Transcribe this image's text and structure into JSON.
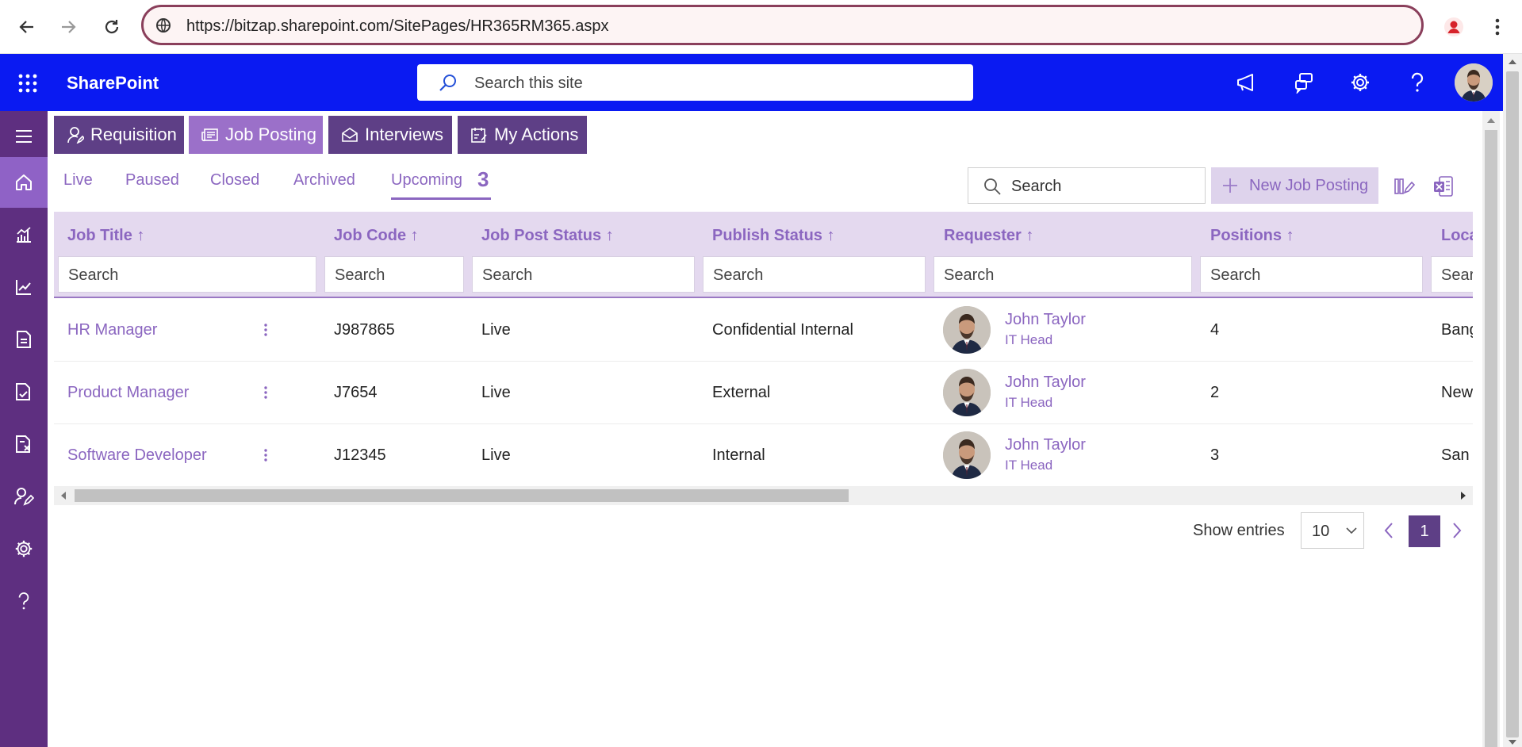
{
  "browser": {
    "url": "https://bitzap.sharepoint.com/SitePages/HR365RM365.aspx",
    "icons": [
      "back-icon",
      "forward-icon",
      "reload-icon",
      "site-info-icon",
      "profile-icon",
      "menu-kebab-icon"
    ]
  },
  "sharepoint": {
    "title": "SharePoint",
    "search_placeholder": "Search this site",
    "icons": [
      "app-launcher-icon",
      "megaphone-icon",
      "chat-icon",
      "gear-icon",
      "help-icon"
    ]
  },
  "rail": {
    "items": [
      "hamburger-icon",
      "home-icon",
      "analytics-icon",
      "trend-icon",
      "document-icon",
      "document-check-icon",
      "document-x-icon",
      "person-edit-icon",
      "gear-icon",
      "help-icon"
    ],
    "active": "home-icon"
  },
  "tabs": [
    {
      "label": "Requisition",
      "icon": "person-icon"
    },
    {
      "label": "Job Posting",
      "icon": "newspaper-icon"
    },
    {
      "label": "Interviews",
      "icon": "mail-open-icon"
    },
    {
      "label": "My Actions",
      "icon": "checklist-icon"
    }
  ],
  "active_tab": "Job Posting",
  "subtabs": [
    {
      "label": "Live"
    },
    {
      "label": "Paused"
    },
    {
      "label": "Closed"
    },
    {
      "label": "Archived"
    },
    {
      "label": "Upcoming",
      "count": "3"
    }
  ],
  "active_subtab": "Upcoming",
  "toolbar": {
    "search_placeholder": "Search",
    "new_button": "New Job Posting"
  },
  "table": {
    "columns": [
      "Job Title",
      "Job Code",
      "Job Post Status",
      "Publish Status",
      "Requester",
      "Positions",
      "Loca"
    ],
    "filter_placeholder": "Search",
    "filter_placeholder_truncated": "Sear",
    "rows": [
      {
        "title": "HR Manager",
        "code": "J987865",
        "post_status": "Live",
        "publish_status": "Confidential Internal",
        "requester_name": "John Taylor",
        "requester_role": "IT Head",
        "positions": "4",
        "location": "Bang"
      },
      {
        "title": "Product Manager",
        "code": "J7654",
        "post_status": "Live",
        "publish_status": "External",
        "requester_name": "John Taylor",
        "requester_role": "IT Head",
        "positions": "2",
        "location": "New"
      },
      {
        "title": "Software Developer",
        "code": "J12345",
        "post_status": "Live",
        "publish_status": "Internal",
        "requester_name": "John Taylor",
        "requester_role": "IT Head",
        "positions": "3",
        "location": "San"
      }
    ]
  },
  "pagination": {
    "show_entries_label": "Show entries",
    "entries_value": "10",
    "current_page": "1"
  },
  "colors": {
    "sharepoint_bar": "#0a1af2",
    "rail": "#5e2f80",
    "accent": "#8b66c0",
    "tab": "#5e3f86",
    "tab_active": "#9b70c9"
  }
}
